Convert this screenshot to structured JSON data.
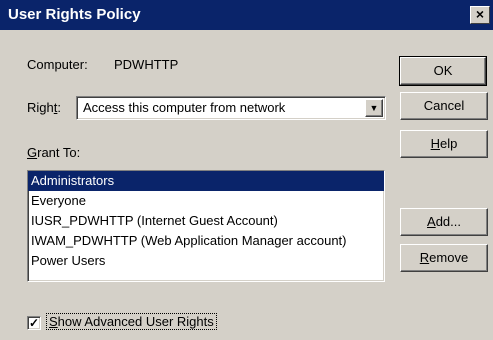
{
  "window": {
    "title": "User Rights Policy",
    "close_glyph": "×"
  },
  "computer": {
    "label": "Computer:",
    "value": "PDWHTTP"
  },
  "right": {
    "label_prefix": "Righ",
    "label_accel": "t",
    "label_suffix": ":",
    "selected": "Access this computer from network",
    "arrow_icon": "chevron-down-icon"
  },
  "grant_to": {
    "label_accel": "G",
    "label_rest": "rant To:",
    "items": [
      {
        "label": "Administrators",
        "selected": true
      },
      {
        "label": "Everyone",
        "selected": false
      },
      {
        "label": "IUSR_PDWHTTP (Internet Guest Account)",
        "selected": false
      },
      {
        "label": "IWAM_PDWHTTP (Web Application Manager account)",
        "selected": false
      },
      {
        "label": "Power Users",
        "selected": false
      }
    ]
  },
  "buttons": {
    "ok": "OK",
    "cancel": "Cancel",
    "help_accel": "H",
    "help_rest": "elp",
    "add_accel": "A",
    "add_rest": "dd...",
    "remove_accel": "R",
    "remove_rest": "emove"
  },
  "advanced": {
    "checked": true,
    "check_glyph": "✓",
    "label_accel": "S",
    "label_rest": "how Advanced User Rights"
  },
  "colors": {
    "titlebar": "#0a246a",
    "face": "#d4d0c8",
    "selection": "#0a246a"
  }
}
